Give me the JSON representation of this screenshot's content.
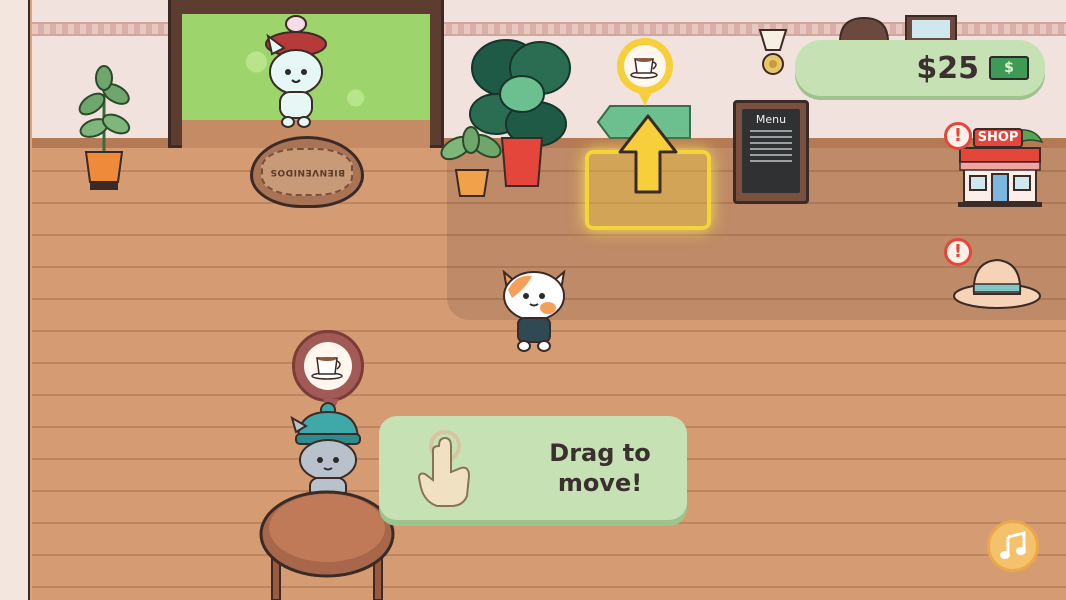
{
  "hud": {
    "money": "$25",
    "money_icon": "cash-icon",
    "music_icon": "music-note-icon"
  },
  "tutorial": {
    "text_line1": "Drag to",
    "text_line2": "move!",
    "icon": "tap-hand-icon"
  },
  "scene": {
    "door_mat_text": "BIENVENIDOS",
    "menu_board_title": "Menu",
    "shop_label": "SHOP",
    "alert_mark": "!",
    "target_icon": "coffee-cup-icon"
  },
  "colors": {
    "ui_green": "#c6e2b4",
    "highlight_yellow": "#f5d43a",
    "alert_red": "#e4463b",
    "floor": "#d59c73"
  }
}
